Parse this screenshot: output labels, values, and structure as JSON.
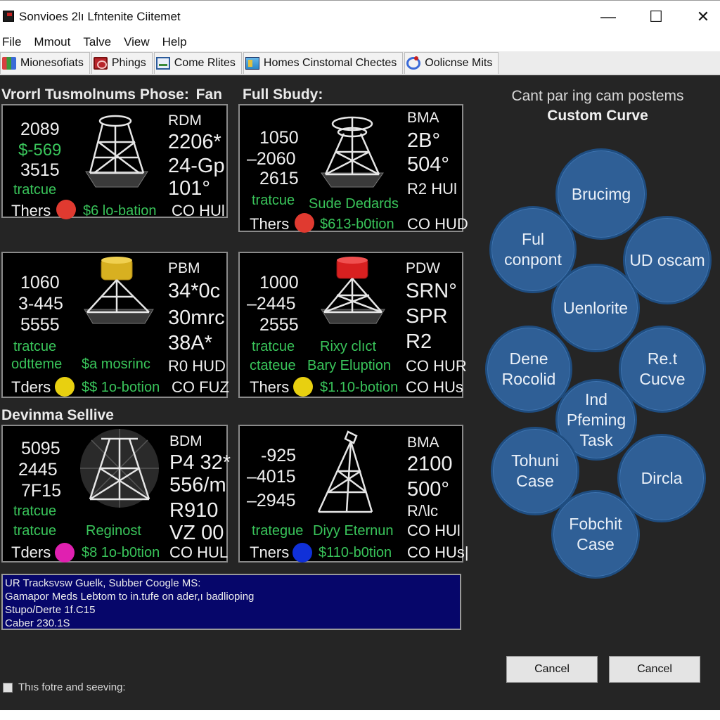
{
  "window": {
    "title": "Sonvioes 2lı Lfntenite Ciitemet",
    "min_glyph": "—",
    "max_glyph": "☐",
    "close_glyph": "✕"
  },
  "menu": [
    "File",
    "Mmout",
    "Talve",
    "View",
    "Help"
  ],
  "toolbar": [
    {
      "label": "Mionesofiats",
      "icon": "monitor-icon"
    },
    {
      "label": "Phings",
      "icon": "ping-icon"
    },
    {
      "label": "Come Rlites",
      "icon": "network-icon"
    },
    {
      "label": "Homes Cinstomal Chectes",
      "icon": "home-icon"
    },
    {
      "label": "Oolicnse Mits",
      "icon": "globe-icon"
    }
  ],
  "sections": {
    "heading1": "Vrorrl Tusmolnums Phose:",
    "heading1_b": "Fan",
    "heading2": "Full Sbudy:",
    "heading3": "Devinma Sellive"
  },
  "panels": [
    {
      "nums": [
        "2089",
        "$-569",
        "3515"
      ],
      "green": [
        "tratcue"
      ],
      "tower_color": "none",
      "right": [
        "RDM",
        "2206*",
        "24-Gp",
        "101°"
      ],
      "bottom_left": "Thers",
      "dot_color": "#e03a30",
      "bottom_mid": "$6 lo-bation",
      "bottom_right": "CO HUl"
    },
    {
      "nums": [
        "1050",
        "–2060",
        "2615"
      ],
      "green": [
        "tratcue",
        "Sude Dedards"
      ],
      "tower_color": "none",
      "right": [
        "BMA",
        "2B°",
        "504°",
        "R2 HUl"
      ],
      "bottom_left": "Thers",
      "dot_color": "#e03a30",
      "bottom_mid": "$613-b0tion",
      "bottom_right": "CO HUD"
    },
    {
      "nums": [
        "1060",
        "3-445",
        "5555"
      ],
      "green": [
        "tratcue",
        "odtteme",
        "$a mosrinc"
      ],
      "tower_color": "#d8b020",
      "right": [
        "PBM",
        "34*0c",
        "30mrc",
        "38A*"
      ],
      "bottom_left": "Tders",
      "dot_color": "#e8d010",
      "bottom_mid": "$$ 1o-botion",
      "bottom_right": "CO FUZ",
      "extra_right": "R0 HUD"
    },
    {
      "nums": [
        "1000",
        "–2445",
        "2555"
      ],
      "green": [
        "tratcue",
        "ctateue",
        "Rixy clıct",
        "Bary Eluption"
      ],
      "tower_color": "#d82020",
      "right": [
        "PDW",
        "SRN°",
        "SPR",
        "R2"
      ],
      "bottom_left": "Thers",
      "dot_color": "#e8d010",
      "bottom_mid": "$1.10-botion",
      "bottom_right": "CO HUs",
      "extra_right": "CO HUR"
    },
    {
      "nums": [
        "5095",
        "2445",
        "7F15"
      ],
      "green": [
        "tratcue",
        "tratcue",
        "Reginost"
      ],
      "tower_color": "none",
      "right": [
        "BDM",
        "P4 32*",
        "556/m",
        "R910",
        "VZ 00"
      ],
      "bottom_left": "Tders",
      "dot_color": "#e020b0",
      "bottom_mid": "$8 1o-b0tion",
      "bottom_right": "CO HUL"
    },
    {
      "nums": [
        "-925",
        "–4015",
        "–2945"
      ],
      "green": [
        "trategue",
        "Diyy Eternun"
      ],
      "tower_color": "none",
      "right": [
        "BMA",
        "2100",
        "500°",
        "R/\\lc",
        "CO HUl"
      ],
      "bottom_left": "Tners",
      "dot_color": "#1030d8",
      "bottom_mid": "$110-b0tion",
      "bottom_right": "CO HUs|"
    }
  ],
  "console": [
    "UR Tracksvsw Guelk,  Subber Coogle MS:",
    "Gamapor Meds Lebtom to in.tufe on ader,ı badlioping",
    "Stupo/Derte 1f.C15",
    "Caber 230.1S"
  ],
  "right_panel": {
    "title": "Cant par ing cam postems",
    "subtitle": "Custom Curve",
    "circles": [
      "Brucimg",
      "Ful conpont",
      "UD oscam",
      "Uenlorite",
      "Dene Rocolid",
      "Re.t Cucve",
      "Ind Pfeming Task",
      "Tohuni Case",
      "Dircla",
      "Fobchit Case"
    ]
  },
  "buttons": [
    "Cancel",
    "Cancel"
  ],
  "checkbox_label": "Thıs fotre and seeving:"
}
